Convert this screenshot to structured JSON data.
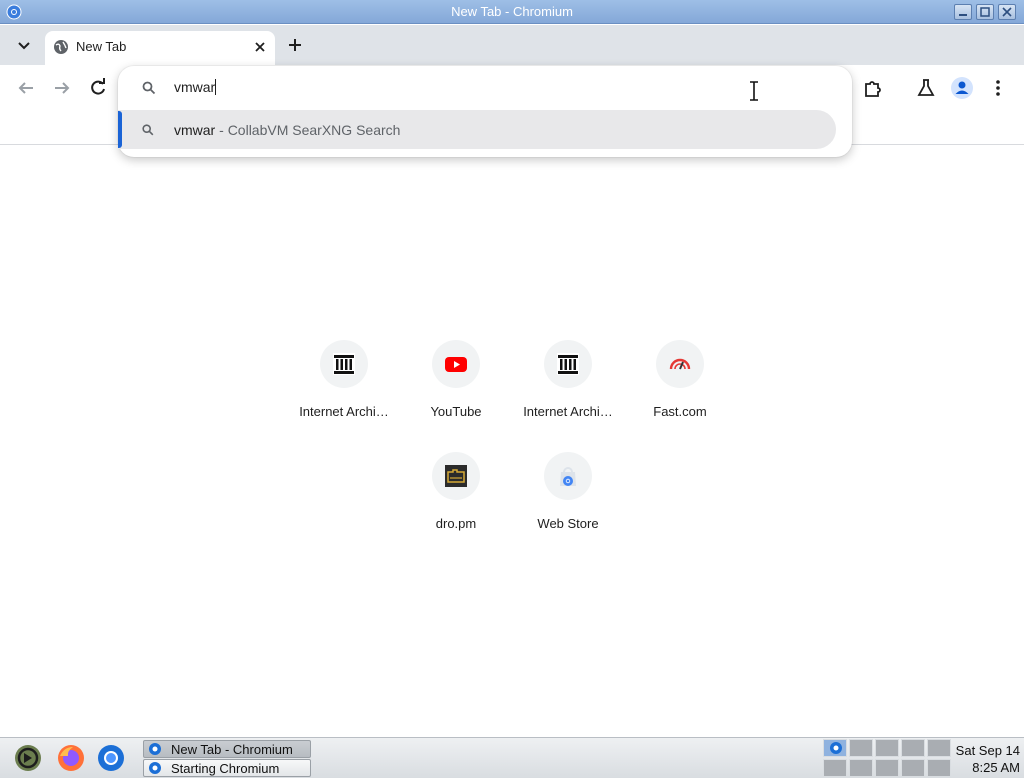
{
  "window": {
    "title": "New Tab - Chromium"
  },
  "tabs": [
    {
      "title": "New Tab"
    }
  ],
  "omnibox": {
    "input_value": "vmwar",
    "suggestion": {
      "query": "vmwar",
      "separator": " - ",
      "provider": "CollabVM SearXNG Search"
    }
  },
  "shortcuts": [
    {
      "label": "Internet Archi…",
      "icon": "internet-archive-icon"
    },
    {
      "label": "YouTube",
      "icon": "youtube-icon"
    },
    {
      "label": "Internet Archi…",
      "icon": "internet-archive-icon"
    },
    {
      "label": "Fast.com",
      "icon": "fast-com-icon"
    },
    {
      "label": "dro.pm",
      "icon": "dro-pm-icon"
    },
    {
      "label": "Web Store",
      "icon": "web-store-icon"
    }
  ],
  "taskbar": {
    "tasks": [
      {
        "label": "New Tab - Chromium",
        "active": true
      },
      {
        "label": "Starting Chromium",
        "active": false
      }
    ],
    "clock": {
      "date": "Sat Sep 14",
      "time": "8:25 AM"
    }
  },
  "colors": {
    "accent": "#1a63d6",
    "titlebar": "#8fb2df",
    "youtube_red": "#ff0000",
    "fast_red": "#e53935"
  }
}
